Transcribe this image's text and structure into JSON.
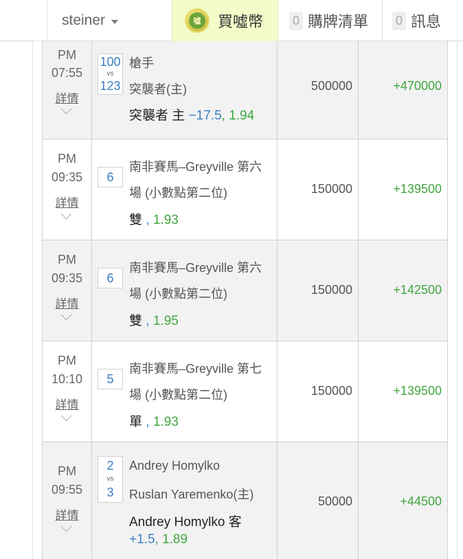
{
  "nav": {
    "username": "steiner",
    "buy_label": "買噓幣",
    "coin_glyph": "噓",
    "list_count": "0",
    "list_label": "購牌清單",
    "msg_count": "0",
    "msg_label": "訊息"
  },
  "rows": [
    {
      "ampm": "PM",
      "time": "07:55",
      "detail": "詳情",
      "score_a": "100",
      "vs": "vs",
      "score_b": "123",
      "team_a": "槍手",
      "team_b": "突襲者(主)",
      "pick": "突襲者 主 ",
      "handicap": "−17.5",
      "sep": ", ",
      "odds": "1.94",
      "stake": "500000",
      "result": "+470000"
    },
    {
      "ampm": "PM",
      "time": "09:35",
      "detail": "詳情",
      "score": "6",
      "line1": "南非賽馬–Greyville 第六",
      "line2": "場 (小數點第二位)",
      "pick": "雙",
      "sep": " , ",
      "odds": "1.93",
      "stake": "150000",
      "result": "+139500"
    },
    {
      "ampm": "PM",
      "time": "09:35",
      "detail": "詳情",
      "score": "6",
      "line1": "南非賽馬–Greyville 第六",
      "line2": "場 (小數點第二位)",
      "pick": "雙",
      "sep": " , ",
      "odds": "1.95",
      "stake": "150000",
      "result": "+142500"
    },
    {
      "ampm": "PM",
      "time": "10:10",
      "detail": "詳情",
      "score": "5",
      "line1": "南非賽馬–Greyville 第七",
      "line2": "場 (小數點第二位)",
      "pick": "單",
      "sep": " , ",
      "odds": "1.93",
      "stake": "150000",
      "result": "+139500"
    },
    {
      "ampm": "PM",
      "time": "09:55",
      "detail": "詳情",
      "score_a": "2",
      "vs": "vs",
      "score_b": "3",
      "team_a": "Andrey Homylko",
      "team_b": "Ruslan Yaremenko(主)",
      "pick": "Andrey Homylko 客",
      "handicap": "+1.5",
      "sep": ", ",
      "odds": "1.89",
      "stake": "50000",
      "result": "+44500"
    }
  ],
  "colors": {
    "accent_blue": "#3a7fc4",
    "win_green": "#3fa63f",
    "buy_bg": "#f1fcc8"
  }
}
